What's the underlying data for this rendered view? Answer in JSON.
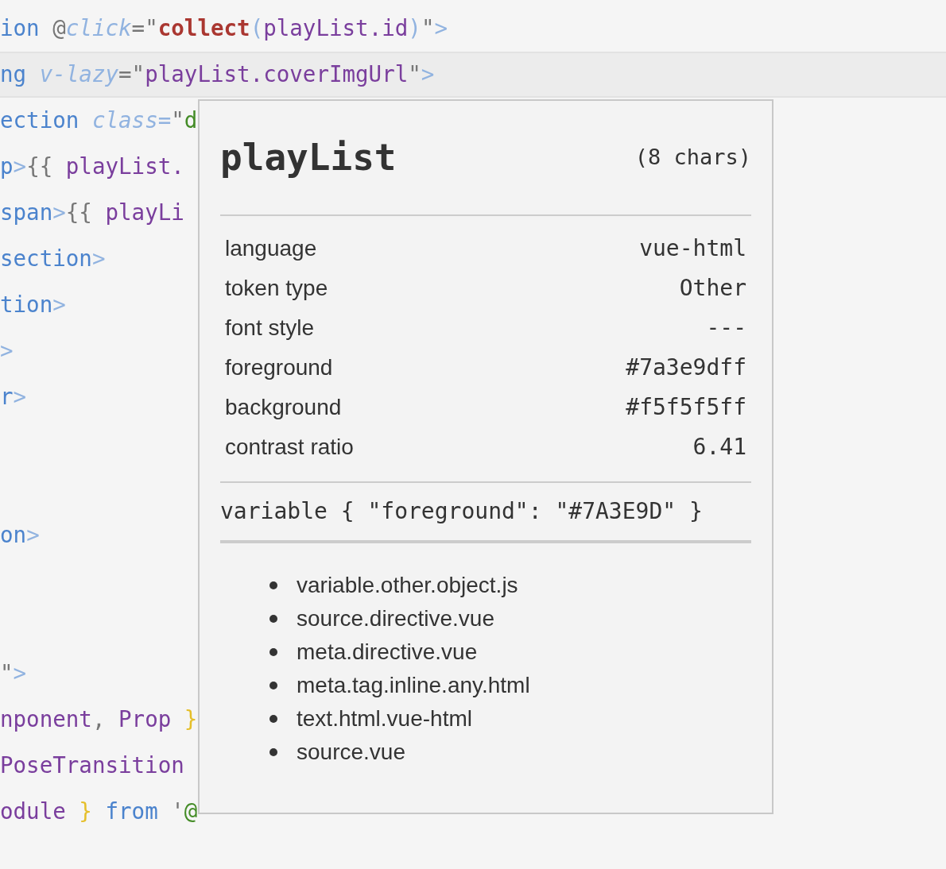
{
  "code_lines": [
    {
      "highlighted": false,
      "tokens": [
        {
          "text": "ion",
          "kind": "tag"
        },
        {
          "text": " @",
          "kind": "punct"
        },
        {
          "text": "click",
          "kind": "attr"
        },
        {
          "text": "=\"",
          "kind": "punct"
        },
        {
          "text": "collect",
          "kind": "func"
        },
        {
          "text": "(",
          "kind": "bracket"
        },
        {
          "text": "playList.id",
          "kind": "var"
        },
        {
          "text": ")",
          "kind": "bracket"
        },
        {
          "text": "\"",
          "kind": "punct"
        },
        {
          "text": ">",
          "kind": "bracket"
        }
      ]
    },
    {
      "highlighted": true,
      "tokens": [
        {
          "text": "ng",
          "kind": "tag"
        },
        {
          "text": " v-lazy",
          "kind": "attr"
        },
        {
          "text": "=\"",
          "kind": "punct"
        },
        {
          "text": "playList.coverImgUrl",
          "kind": "var"
        },
        {
          "text": "\"",
          "kind": "punct"
        },
        {
          "text": ">",
          "kind": "bracket"
        }
      ]
    },
    {
      "highlighted": false,
      "tokens": [
        {
          "text": "ection",
          "kind": "tag"
        },
        {
          "text": " class=",
          "kind": "attr"
        },
        {
          "text": "\"",
          "kind": "punct"
        },
        {
          "text": "d",
          "kind": "string"
        }
      ]
    },
    {
      "highlighted": false,
      "tokens": [
        {
          "text": "p",
          "kind": "tag"
        },
        {
          "text": ">",
          "kind": "bracket"
        },
        {
          "text": "{{ ",
          "kind": "punct"
        },
        {
          "text": "playList.",
          "kind": "var"
        }
      ]
    },
    {
      "highlighted": false,
      "tokens": [
        {
          "text": "span",
          "kind": "tag"
        },
        {
          "text": ">",
          "kind": "bracket"
        },
        {
          "text": "{{ ",
          "kind": "punct"
        },
        {
          "text": "playLi",
          "kind": "var"
        }
      ]
    },
    {
      "highlighted": false,
      "tokens": [
        {
          "text": "section",
          "kind": "tag"
        },
        {
          "text": ">",
          "kind": "bracket"
        }
      ]
    },
    {
      "highlighted": false,
      "tokens": [
        {
          "text": "tion",
          "kind": "tag"
        },
        {
          "text": ">",
          "kind": "bracket"
        }
      ]
    },
    {
      "highlighted": false,
      "tokens": [
        {
          "text": ">",
          "kind": "bracket"
        }
      ]
    },
    {
      "highlighted": false,
      "tokens": [
        {
          "text": "r",
          "kind": "tag"
        },
        {
          "text": ">",
          "kind": "bracket"
        }
      ]
    },
    {
      "highlighted": false
    },
    {
      "highlighted": false
    },
    {
      "highlighted": false,
      "tokens": [
        {
          "text": "on",
          "kind": "tag"
        },
        {
          "text": ">",
          "kind": "bracket"
        }
      ]
    },
    {
      "highlighted": false
    },
    {
      "highlighted": false
    },
    {
      "highlighted": false,
      "tokens": [
        {
          "text": "\"",
          "kind": "punct"
        },
        {
          "text": ">",
          "kind": "bracket"
        }
      ]
    },
    {
      "highlighted": false,
      "tokens": [
        {
          "text": "nponent",
          "kind": "var"
        },
        {
          "text": ", ",
          "kind": "punct"
        },
        {
          "text": "Prop",
          "kind": "var"
        },
        {
          "text": " }",
          "kind": "brace"
        }
      ]
    },
    {
      "highlighted": false,
      "tokens": [
        {
          "text": "PoseTransition",
          "kind": "var"
        }
      ]
    },
    {
      "highlighted": false,
      "tokens": [
        {
          "text": "odule",
          "kind": "var"
        },
        {
          "text": " }",
          "kind": "brace"
        },
        {
          "text": " from",
          "kind": "tag"
        },
        {
          "text": " '",
          "kind": "punct"
        },
        {
          "text": "@",
          "kind": "string"
        }
      ]
    }
  ],
  "tooltip": {
    "title": "playList",
    "char_count": "(8 chars)",
    "properties": [
      {
        "label": "language",
        "value": "vue-html"
      },
      {
        "label": "token type",
        "value": "Other"
      },
      {
        "label": "font style",
        "value": "---"
      },
      {
        "label": "foreground",
        "value": "#7a3e9dff"
      },
      {
        "label": "background",
        "value": "#f5f5f5ff"
      },
      {
        "label": "contrast ratio",
        "value": "6.41"
      }
    ],
    "rule": "variable { \"foreground\": \"#7A3E9D\" }",
    "scopes": [
      "variable.other.object.js",
      "source.directive.vue",
      "meta.directive.vue",
      "meta.tag.inline.any.html",
      "text.html.vue-html",
      "source.vue"
    ]
  }
}
